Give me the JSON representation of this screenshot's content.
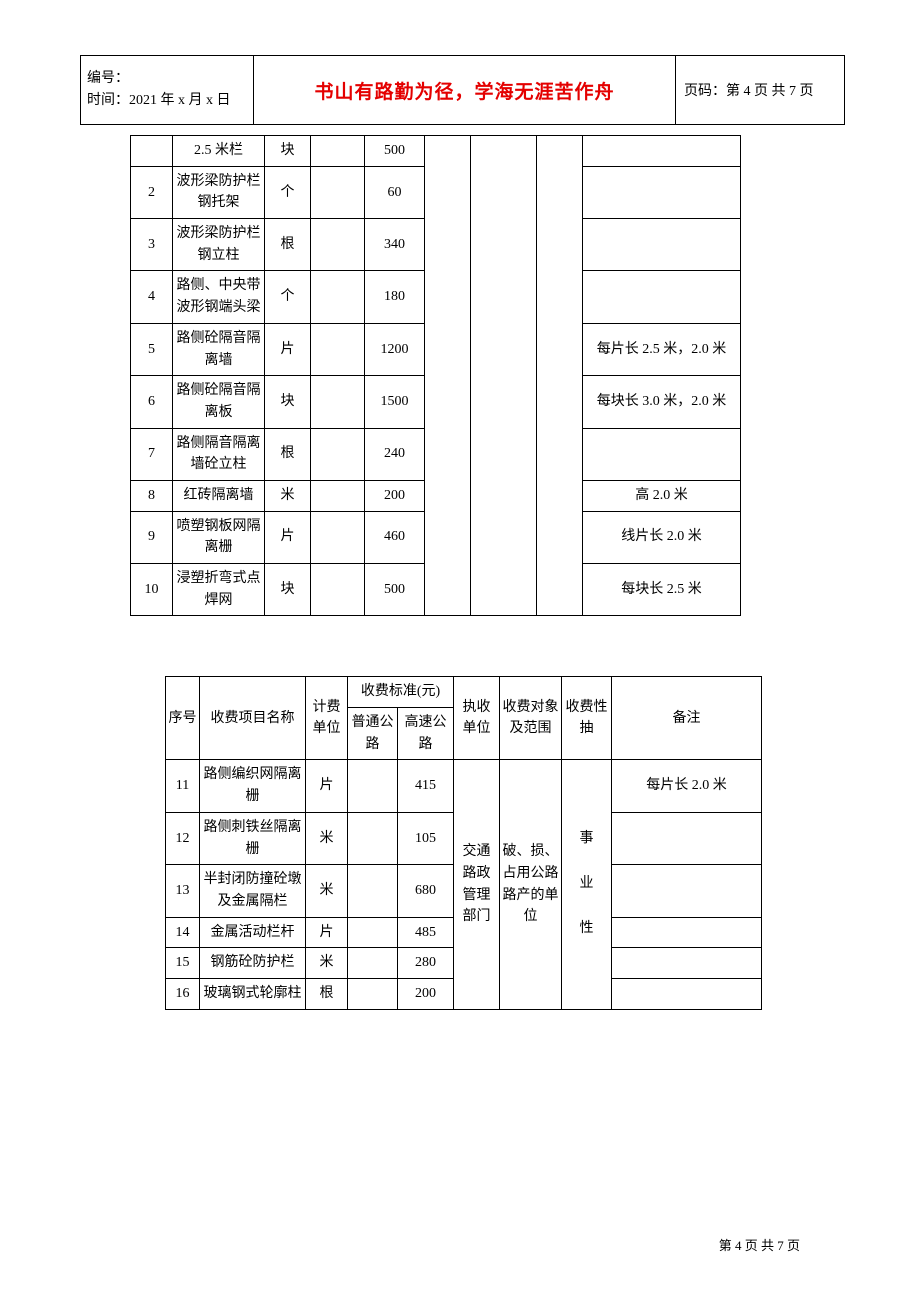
{
  "header": {
    "numbering_label": "编号：",
    "date_label": "时间：2021 年 x 月 x 日",
    "motto": "书山有路勤为径，学海无涯苦作舟",
    "page_label": "页码：第 4 页  共 7 页"
  },
  "footer": "第 4 页 共 7 页",
  "table1": {
    "rows": [
      {
        "idx": "",
        "name": "2.5 米栏",
        "unit": "块",
        "std1": "",
        "std2": "500",
        "note": ""
      },
      {
        "idx": "2",
        "name": "波形梁防护栏钢托架",
        "unit": "个",
        "std1": "",
        "std2": "60",
        "note": ""
      },
      {
        "idx": "3",
        "name": "波形梁防护栏钢立柱",
        "unit": "根",
        "std1": "",
        "std2": "340",
        "note": ""
      },
      {
        "idx": "4",
        "name": "路侧、中央带波形钢端头梁",
        "unit": "个",
        "std1": "",
        "std2": "180",
        "note": ""
      },
      {
        "idx": "5",
        "name": "路侧砼隔音隔离墙",
        "unit": "片",
        "std1": "",
        "std2": "1200",
        "note": "每片长 2.5 米，2.0 米"
      },
      {
        "idx": "6",
        "name": "路侧砼隔音隔离板",
        "unit": "块",
        "std1": "",
        "std2": "1500",
        "note": "每块长 3.0 米，2.0 米"
      },
      {
        "idx": "7",
        "name": "路侧隔音隔离墙砼立柱",
        "unit": "根",
        "std1": "",
        "std2": "240",
        "note": ""
      },
      {
        "idx": "8",
        "name": "红砖隔离墙",
        "unit": "米",
        "std1": "",
        "std2": "200",
        "note": "高 2.0 米"
      },
      {
        "idx": "9",
        "name": "喷塑钢板网隔离栅",
        "unit": "片",
        "std1": "",
        "std2": "460",
        "note": "线片长 2.0 米"
      },
      {
        "idx": "10",
        "name": "浸塑折弯式点焊网",
        "unit": "块",
        "std1": "",
        "std2": "500",
        "note": "每块长 2.5 米"
      }
    ],
    "merged_dept": "",
    "merged_obj": "",
    "merged_nat": ""
  },
  "table2": {
    "headers": {
      "idx": "序号",
      "name": "收费项目名称",
      "unit": "计费单位",
      "std_group": "收费标准(元)",
      "std1": "普通公路",
      "std2": "高速公路",
      "dept": "执收单位",
      "obj": "收费对象及范围",
      "nat": "收费性抽",
      "note": "备注"
    },
    "rows": [
      {
        "idx": "11",
        "name": "路侧编织网隔离栅",
        "unit": "片",
        "std1": "",
        "std2": "415",
        "note": "每片长 2.0 米"
      },
      {
        "idx": "12",
        "name": "路侧刺铁丝隔离栅",
        "unit": "米",
        "std1": "",
        "std2": "105",
        "note": ""
      },
      {
        "idx": "13",
        "name": "半封闭防撞砼墩及金属隔栏",
        "unit": "米",
        "std1": "",
        "std2": "680",
        "note": ""
      },
      {
        "idx": "14",
        "name": "金属活动栏杆",
        "unit": "片",
        "std1": "",
        "std2": "485",
        "note": ""
      },
      {
        "idx": "15",
        "name": "钢筋砼防护栏",
        "unit": "米",
        "std1": "",
        "std2": "280",
        "note": ""
      },
      {
        "idx": "16",
        "name": "玻璃钢式轮廓柱",
        "unit": "根",
        "std1": "",
        "std2": "200",
        "note": ""
      }
    ],
    "merged_dept": "交通路政管理部门",
    "merged_obj": "破、损、占用公路路产的单位",
    "merged_nat_lines": [
      "事",
      "业",
      "性"
    ]
  }
}
